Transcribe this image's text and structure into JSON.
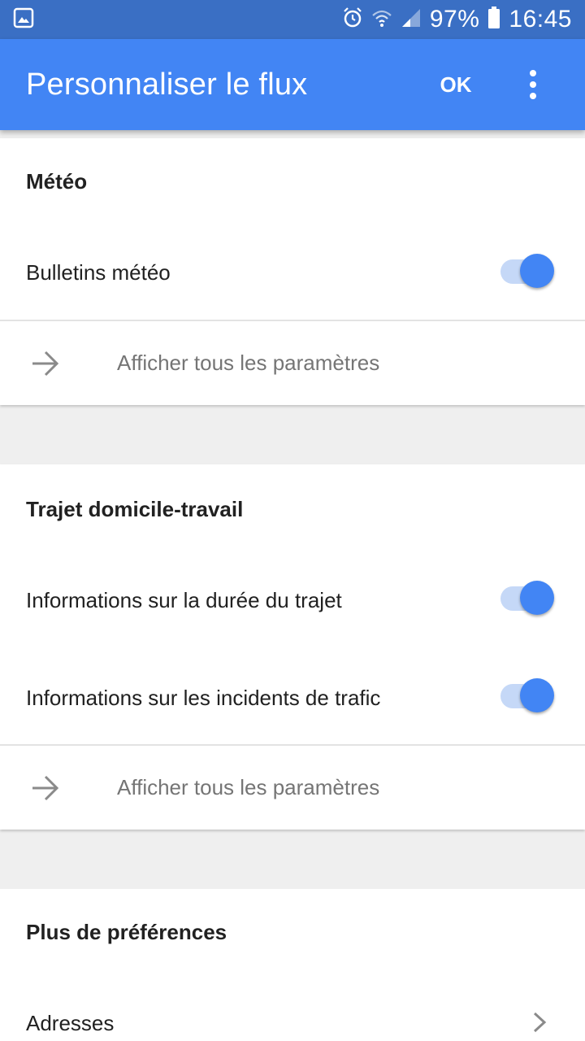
{
  "status_bar": {
    "battery": "97%",
    "time": "16:45",
    "icons": [
      "image-icon",
      "alarm-icon",
      "wifi-icon",
      "signal-icon",
      "battery-icon"
    ]
  },
  "app_bar": {
    "title": "Personnaliser le flux",
    "ok_label": "OK",
    "menu_icon": "more-vert-icon",
    "color": "#4285f4"
  },
  "weather_card": {
    "title": "Météo",
    "rows": [
      {
        "label": "Bulletins météo",
        "enabled": true
      }
    ],
    "link": {
      "label": "Afficher tous les paramètres",
      "icon": "arrow-right-icon"
    }
  },
  "commute_card": {
    "title": "Trajet domicile-travail",
    "rows": [
      {
        "label": "Informations sur la durée du trajet",
        "enabled": true
      },
      {
        "label": "Informations sur les incidents de trafic",
        "enabled": true
      }
    ],
    "link": {
      "label": "Afficher tous les paramètres",
      "icon": "arrow-right-icon"
    }
  },
  "prefs_card": {
    "title": "Plus de préférences",
    "rows": [
      {
        "label": "Adresses",
        "icon": "chevron-right-icon"
      }
    ]
  }
}
